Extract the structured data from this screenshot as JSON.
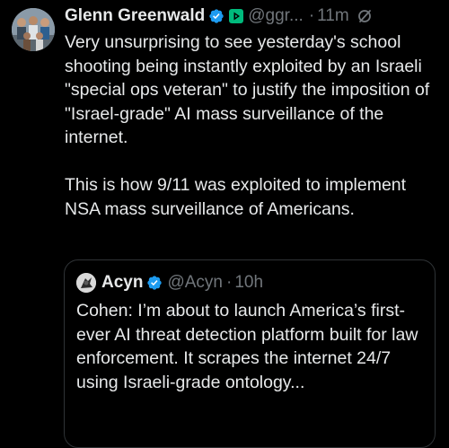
{
  "tweet": {
    "author_name": "Glenn Greenwald",
    "handle": "@ggr...",
    "separator": "·",
    "time": "11m",
    "paragraphs": [
      "Very unsurprising to see yesterday's school shooting being instantly exploited by an Israeli \"special ops veteran\" to justify the imposition of \"Israel-grade\" AI mass surveillance of the internet.",
      "This is how 9/11 was exploited to implement NSA mass surveillance of Americans."
    ]
  },
  "quote": {
    "author_name": "Acyn",
    "handle": "@Acyn",
    "separator": "·",
    "time": "10h",
    "text": "Cohen: I’m about to launch America’s first-ever AI threat detection platform built for law enforcement. It scrapes the internet 24/7 using Israeli-grade ontology..."
  },
  "icons": {
    "verified": "verified-badge-icon",
    "subscribe": "subscription-badge-icon",
    "edited": "edited-icon"
  },
  "colors": {
    "background": "#000000",
    "text": "#e7e9ea",
    "secondary": "#71767b",
    "verified_blue": "#1d9bf0",
    "subscribe_green": "#00ba7c",
    "border": "#2f3336"
  }
}
